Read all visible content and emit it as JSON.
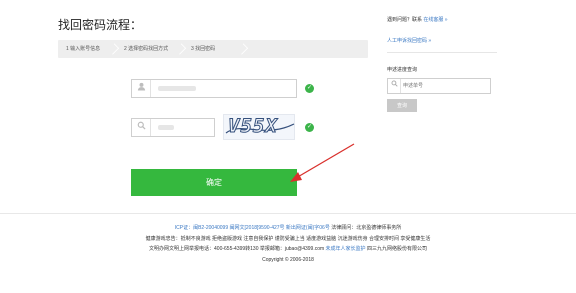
{
  "page": {
    "title": "找回密码流程："
  },
  "steps": [
    {
      "label": "1 输入账号信息"
    },
    {
      "label": "2 选择密码找回方式"
    },
    {
      "label": "3 找回密码"
    }
  ],
  "form": {
    "username_placeholder": "",
    "captcha_text": "V55X",
    "confirm_label": "确定"
  },
  "icons": {
    "user": "user-icon",
    "search": "search-icon",
    "check": "check-icon"
  },
  "sidebar": {
    "help_prefix": "遇到问题？联系",
    "help_link": "在线客服 »",
    "manual_link": "人工申诉找回密码 »",
    "query_heading": "申述进度查询",
    "query_placeholder": "申述单号",
    "query_button": "查询"
  },
  "footer": {
    "line1_license": "ICP证：闽B2-20040099 闽网文[2018]9590-427号 新出网证(闽)字06号",
    "line1_law": "法律顾问：北京盈德律师事务所",
    "line2": "健康游戏忠告：抵制不良游戏 拒绝盗版游戏 注意自我保护 谨防受骗上当 适度游戏益脑 沉迷游戏伤身 合理安排时间 享受健康生活",
    "line3_prefix": "文明办网文明上网举报电话：400-655-4399转130 举报邮箱：jubao@4399.com",
    "line3_link": "未成年人家长监护",
    "line3_suffix": "四三九九网络股份有限公司",
    "copyright": "Copyright © 2006-2018"
  },
  "colors": {
    "accent_green": "#35b83e",
    "link_blue": "#3a78c3",
    "annotation_red": "#d9302c"
  }
}
